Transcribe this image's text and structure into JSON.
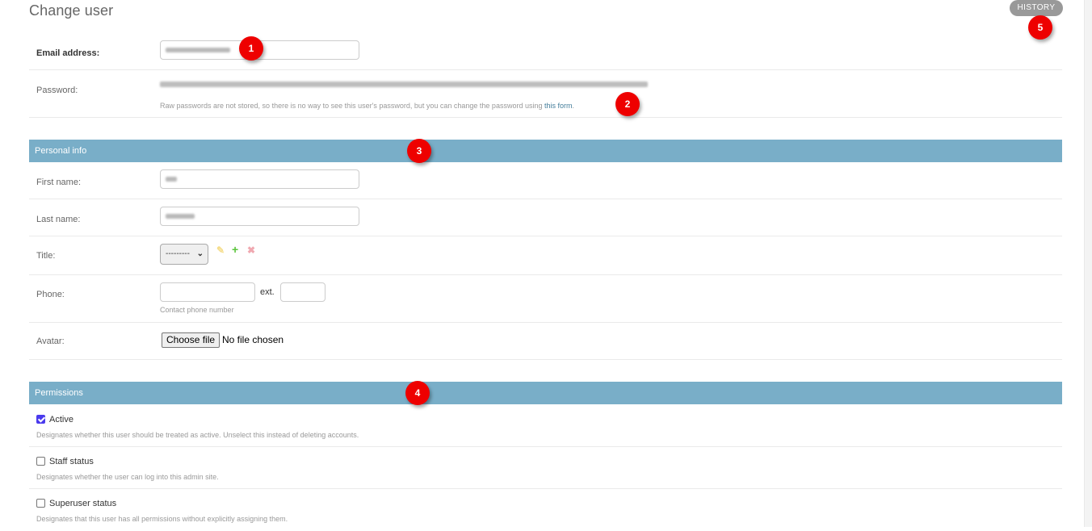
{
  "page": {
    "title": "Change user",
    "history_label": "History"
  },
  "account": {
    "email_label": "Email address:",
    "email_value": "[redacted]@gmail.com",
    "password_label": "Password:",
    "password_value": "[redacted password hash]",
    "password_help_prefix": "Raw passwords are not stored, so there is no way to see this user's password, but you can change the password using ",
    "password_help_link": "this form",
    "password_help_suffix": "."
  },
  "personal_info": {
    "header": "Personal info",
    "first_name_label": "First name:",
    "first_name_value": "[redacted]",
    "last_name_label": "Last name:",
    "last_name_value": "[redacted]",
    "title_label": "Title:",
    "title_selected": "---------",
    "title_icons": [
      "edit-pencil-icon",
      "add-plus-icon",
      "delete-x-icon"
    ],
    "phone_label": "Phone:",
    "phone_value": "",
    "phone_ext_label": "ext.",
    "phone_ext_value": "",
    "phone_help": "Contact phone number",
    "avatar_label": "Avatar:",
    "avatar_button": "Choose file",
    "avatar_status": "No file chosen"
  },
  "permissions": {
    "header": "Permissions",
    "items": [
      {
        "label": "Active",
        "checked": true,
        "help": "Designates whether this user should be treated as active. Unselect this instead of deleting accounts."
      },
      {
        "label": "Staff status",
        "checked": false,
        "help": "Designates whether the user can log into this admin site."
      },
      {
        "label": "Superuser status",
        "checked": false,
        "help": "Designates that this user has all permissions without explicitly assigning them."
      }
    ]
  },
  "annotations": [
    "1",
    "2",
    "3",
    "4",
    "5"
  ],
  "colors": {
    "fieldset_header": "#79aec8",
    "link": "#447e9b",
    "badge": "#ee0000",
    "history_button": "#999999",
    "checkbox_checked": "#4a3aed"
  }
}
